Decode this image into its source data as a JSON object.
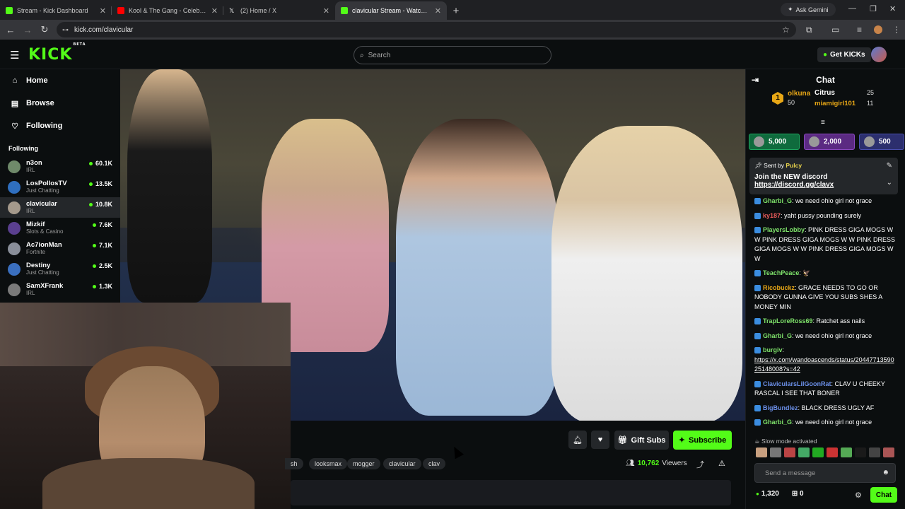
{
  "browser": {
    "tabs": [
      {
        "title": "Stream - Kick Dashboard",
        "favicon_color": "#53fc18"
      },
      {
        "title": "Kool & The Gang - Celebration",
        "favicon_color": "#ff0000"
      },
      {
        "title": "(2) Home / X",
        "favicon_color": "#ffffff"
      },
      {
        "title": "clavicular Stream - Watch Li",
        "favicon_color": "#53fc18"
      }
    ],
    "new_tab": "+",
    "ask_gemini": "Ask Gemini",
    "url": "kick.com/clavicular"
  },
  "header": {
    "logo": "KICK",
    "logo_beta": "BETA",
    "search_placeholder": "Search",
    "get_kicks": "Get KICKs"
  },
  "sidebar": {
    "nav": [
      {
        "label": "Home",
        "icon": "home-icon",
        "glyph": "⌂"
      },
      {
        "label": "Browse",
        "icon": "browse-icon",
        "glyph": "▤"
      },
      {
        "label": "Following",
        "icon": "heart-icon",
        "glyph": "♡"
      }
    ],
    "following_heading": "Following",
    "channels": [
      {
        "name": "n3on",
        "category": "IRL",
        "viewers": "60.1K",
        "avatar_color": "#6f8a6a"
      },
      {
        "name": "LosPollosTV",
        "category": "Just Chatting",
        "viewers": "13.5K",
        "avatar_color": "#2f6fbf"
      },
      {
        "name": "clavicular",
        "category": "IRL",
        "viewers": "10.8K",
        "avatar_color": "#a59a8c"
      },
      {
        "name": "Mizkif",
        "category": "Slots & Casino",
        "viewers": "7.6K",
        "avatar_color": "#5a3f8f"
      },
      {
        "name": "Ac7ionMan",
        "category": "Fortnite",
        "viewers": "7.1K",
        "avatar_color": "#8a8f9a"
      },
      {
        "name": "Destiny",
        "category": "Just Chatting",
        "viewers": "2.5K",
        "avatar_color": "#3a6fbf"
      },
      {
        "name": "SamXFrank",
        "category": "IRL",
        "viewers": "1.3K",
        "avatar_color": "#7a7a7a"
      }
    ]
  },
  "stream": {
    "gift_subs": "Gift Subs",
    "subscribe": "Subscribe",
    "tags": [
      "sh",
      "looksmax",
      "mogger",
      "clavicular",
      "clav"
    ],
    "viewer_count": "10,762",
    "viewers_label": "Viewers"
  },
  "chat": {
    "title": "Chat",
    "leaderboard": {
      "rank": "1",
      "first": {
        "user": "olkuna",
        "points": "50"
      },
      "second": {
        "user": "Citrus",
        "points": "25"
      },
      "third": {
        "user": "miamigirl101",
        "points": "11"
      }
    },
    "gift_goals": [
      {
        "amount": "5,000",
        "color": "#0f6b3d"
      },
      {
        "amount": "2,000",
        "color": "#5b2a82"
      },
      {
        "amount": "500",
        "color": "#2c2f6e"
      }
    ],
    "pinned": {
      "sent_by_label": "Sent by",
      "sent_by_user": "Pulcy",
      "title": "Join the NEW discord",
      "link": "https://discord.gg/clavx"
    },
    "messages": [
      {
        "user": "Gharbi_G",
        "color": "#7fe36b",
        "text": "we need ohio girl not grace"
      },
      {
        "user": "ky187",
        "color": "#e85b5b",
        "text": "yaht pussy pounding surely"
      },
      {
        "user": "PlayersLobby",
        "color": "#7fe36b",
        "text": "PINK DRESS GIGA MOGS W W PINK DRESS GIGA MOGS W W PINK DRESS GIGA MOGS W W PINK DRESS GIGA MOGS W W"
      },
      {
        "user": "TeachPeace",
        "color": "#7fe36b",
        "text": "🦅"
      },
      {
        "user": "Ricobuckz",
        "color": "#e8a716",
        "text": "GRACE NEEDS TO GO OR NOBODY GUNNA GIVE YOU SUBS SHES A MONEY MIN"
      },
      {
        "user": "TrapLoreRoss69",
        "color": "#7fe36b",
        "text": "Ratchet ass nails"
      },
      {
        "user": "Gharbi_G",
        "color": "#7fe36b",
        "text": "we need ohio girl not grace"
      },
      {
        "user": "burgiv",
        "color": "#7fe36b",
        "text": "https://x.com/wandoascends/status/2044771359025148008?s=42"
      },
      {
        "user": "ClavicularsLilGoonRat",
        "color": "#6b8fe8",
        "text": "CLAV U CHEEKY RASCAL I SEE THAT BONER"
      },
      {
        "user": "BigBundlez",
        "color": "#6b8fe8",
        "text": "BLACK DRESS UGLY AF"
      },
      {
        "user": "Gharbi_G",
        "color": "#7fe36b",
        "text": "we need ohio girl not grace"
      }
    ],
    "slow_mode": "Slow mode activated",
    "send_placeholder": "Send a message",
    "points": "1,320",
    "gifts_count": "0",
    "chat_button": "Chat"
  }
}
